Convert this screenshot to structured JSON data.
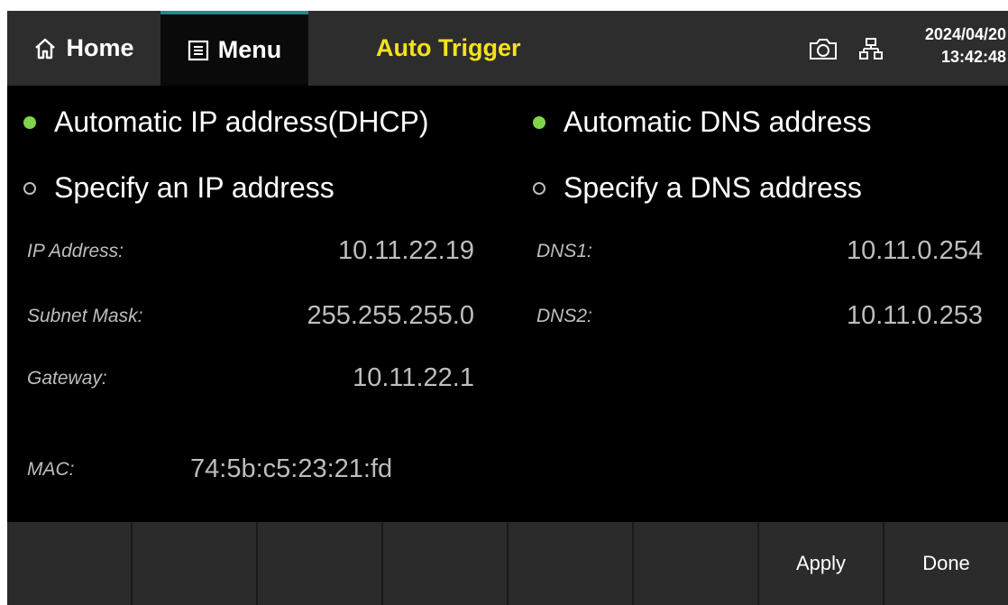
{
  "header": {
    "home_label": "Home",
    "menu_label": "Menu",
    "title": "Auto Trigger",
    "date": "2024/04/20",
    "time": "13:42:48"
  },
  "ip_mode": {
    "options": [
      {
        "label": "Automatic IP address(DHCP)",
        "selected": true
      },
      {
        "label": "Specify an IP address",
        "selected": false
      }
    ]
  },
  "dns_mode": {
    "options": [
      {
        "label": "Automatic DNS address",
        "selected": true
      },
      {
        "label": "Specify a DNS address",
        "selected": false
      }
    ]
  },
  "fields": {
    "ip_address": {
      "label": "IP Address:",
      "value": "10.11.22.19"
    },
    "subnet_mask": {
      "label": "Subnet Mask:",
      "value": "255.255.255.0"
    },
    "gateway": {
      "label": "Gateway:",
      "value": "10.11.22.1"
    },
    "mac": {
      "label": "MAC:",
      "value": "74:5b:c5:23:21:fd"
    },
    "dns1": {
      "label": "DNS1:",
      "value": "10.11.0.254"
    },
    "dns2": {
      "label": "DNS2:",
      "value": "10.11.0.253"
    }
  },
  "softkeys": [
    "",
    "",
    "",
    "",
    "",
    "",
    "Apply",
    "Done"
  ],
  "colors": {
    "title_yellow": "#f5e21a",
    "radio_selected_green": "#7fd44b",
    "menu_tab_accent": "#1f8f8a"
  }
}
